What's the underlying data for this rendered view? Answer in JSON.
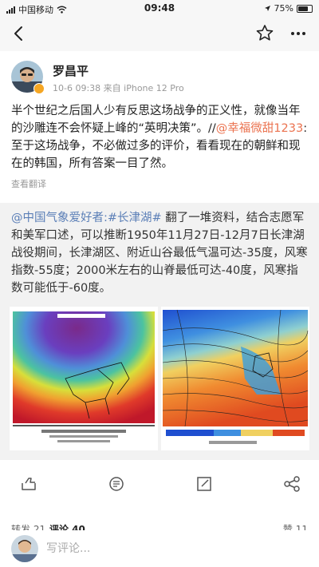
{
  "status_bar": {
    "carrier": "中国移动",
    "time": "09:48",
    "battery": "75%",
    "battery_level": 0.75
  },
  "nav": {
    "back_icon": "chevron-left-icon",
    "star_icon": "star-outline-icon",
    "more_icon": "more-dots-icon"
  },
  "post": {
    "author": "罗昌平",
    "meta": "10-6 09:38   来自 iPhone 12 Pro",
    "text_before": "半个世纪之后国人少有反思这场战争的正义性，就像当年的沙雕连不会怀疑上峰的“英明决策”。//",
    "mention": "@幸福微甜1233",
    "text_after": ":至于这场战争，不必做过多的评价，看看现在的朝鲜和现在的韩国，所有答案一目了然。",
    "translate": "查看翻译"
  },
  "repost": {
    "mention": "@中国气象爱好者",
    "hashtag": ":#长津湖#",
    "text": " 翻了一堆资料，结合志愿军和美军口述，可以推断1950年11月27日-12月7日长津湖战役期间，长津湖区、附近山谷最低气温可达-35度，风寒指数-55度；2000米左右的山脊最低可达-40度，风寒指数可能低于-60度。"
  },
  "actions": {
    "repost_icon": "repost-icon",
    "comment_icon": "comment-icon",
    "edit_icon": "edit-icon",
    "share_icon": "share-icon"
  },
  "tabs": {
    "repost": "转发 21",
    "comment": "评论 40",
    "like": "赞 11"
  },
  "comment_bar": {
    "placeholder": "写评论..."
  }
}
